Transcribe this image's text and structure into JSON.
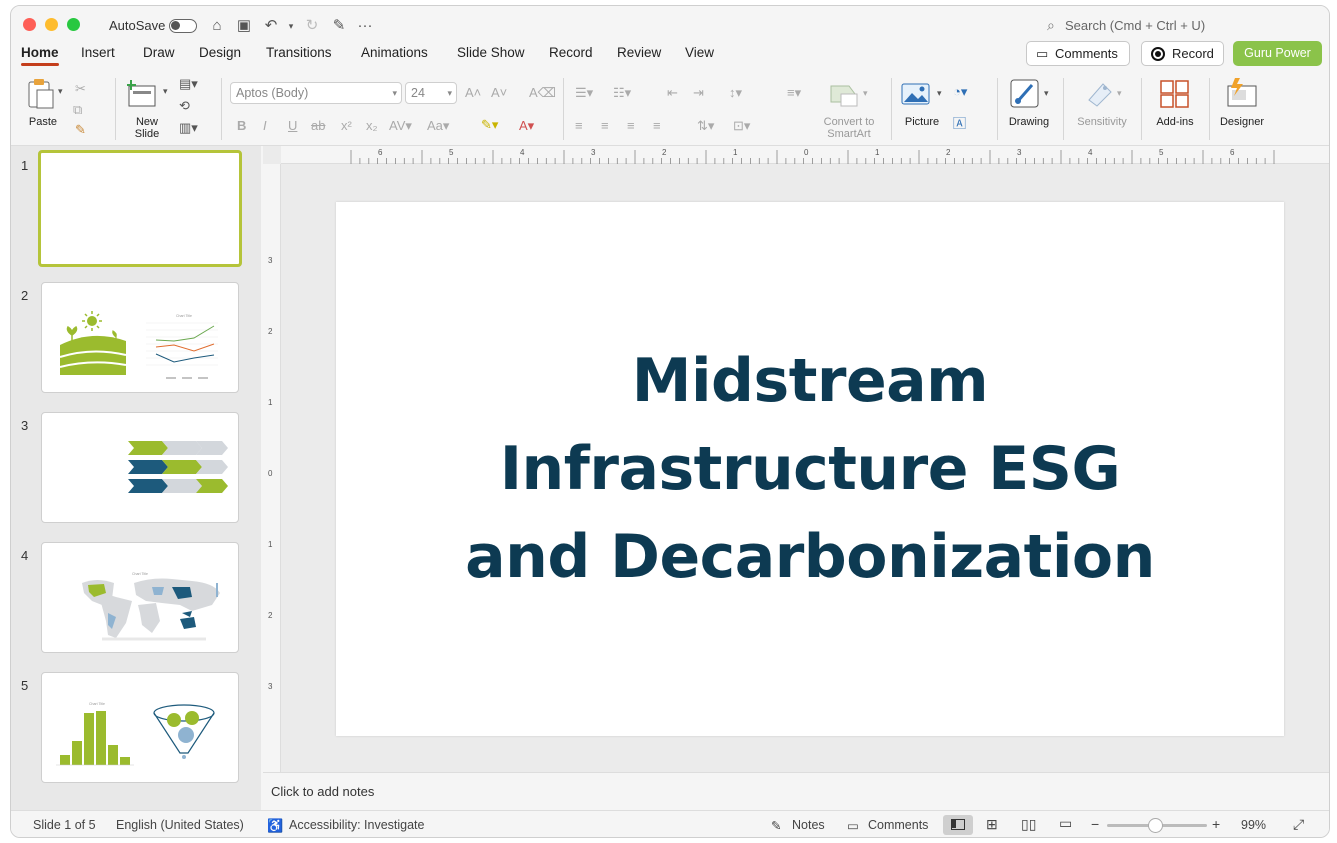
{
  "titlebar": {
    "autosave_label": "AutoSave",
    "search_placeholder": "Search (Cmd + Ctrl + U)"
  },
  "tabs": [
    "Home",
    "Insert",
    "Draw",
    "Design",
    "Transitions",
    "Animations",
    "Slide Show",
    "Record",
    "Review",
    "View"
  ],
  "header_buttons": {
    "comments": "Comments",
    "record": "Record",
    "guru": "Guru Power"
  },
  "ribbon": {
    "paste": "Paste",
    "new_slide_1": "New",
    "new_slide_2": "Slide",
    "font_name": "Aptos (Body)",
    "font_size": "24",
    "convert_1": "Convert to",
    "convert_2": "SmartArt",
    "picture": "Picture",
    "drawing": "Drawing",
    "sensitivity": "Sensitivity",
    "addins": "Add-ins",
    "designer": "Designer"
  },
  "slides": [
    {
      "num": "1"
    },
    {
      "num": "2"
    },
    {
      "num": "3"
    },
    {
      "num": "4"
    },
    {
      "num": "5"
    }
  ],
  "thumb_texts": {
    "chart_title": "Chart Title"
  },
  "slide": {
    "title_line1": "Midstream",
    "title_line2": "Infrastructure ESG",
    "title_line3": "and Decarbonization"
  },
  "notes_placeholder": "Click to add notes",
  "status": {
    "slide_count": "Slide 1 of 5",
    "language": "English (United States)",
    "accessibility": "Accessibility: Investigate",
    "notes": "Notes",
    "comments": "Comments",
    "zoom": "99%"
  },
  "colors": {
    "accent": "#c43e1c",
    "guru": "#8bc34a",
    "title": "#0d3a52",
    "lime": "#9bbb2e",
    "navy": "#1d5a7c"
  }
}
